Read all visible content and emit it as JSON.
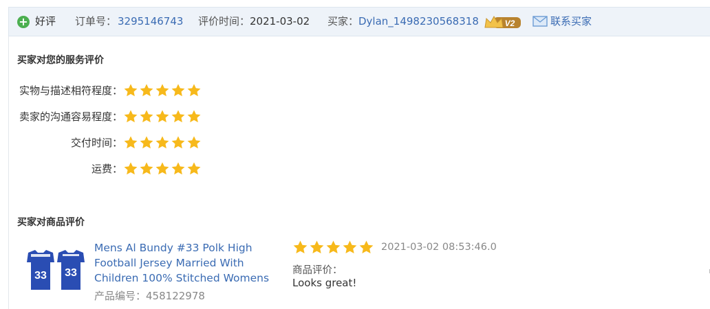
{
  "header": {
    "rating_label": "好评",
    "order_label": "订单号：",
    "order_number": "3295146743",
    "review_time_label": "评价时间：",
    "review_time": "2021-03-02",
    "buyer_label": "买家：",
    "buyer_name": "Dylan_1498230568318",
    "buyer_level": "V2",
    "contact_buyer": "联系买家"
  },
  "service_review": {
    "title": "买家对您的服务评价",
    "ratings": [
      {
        "label": "实物与描述相符程度：",
        "stars": 5
      },
      {
        "label": "卖家的沟通容易程度：",
        "stars": 5
      },
      {
        "label": "交付时间：",
        "stars": 5
      },
      {
        "label": "运费：",
        "stars": 5
      }
    ]
  },
  "product_review": {
    "title": "买家对商品评价",
    "product_title": "Mens Al Bundy #33 Polk High Football Jersey Married With Children 100% Stitched Womens",
    "product_no_label": "产品编号：",
    "product_no": "458122978",
    "jersey_number": "33",
    "stars": 5,
    "time": "2021-03-02 08:53:46.0",
    "review_label": "商品评价：",
    "review_text": "Looks great!"
  },
  "colors": {
    "star": "#f7b91b",
    "link": "#3a6bb3",
    "good": "#4caf50",
    "header_bg": "#eef3f9"
  }
}
